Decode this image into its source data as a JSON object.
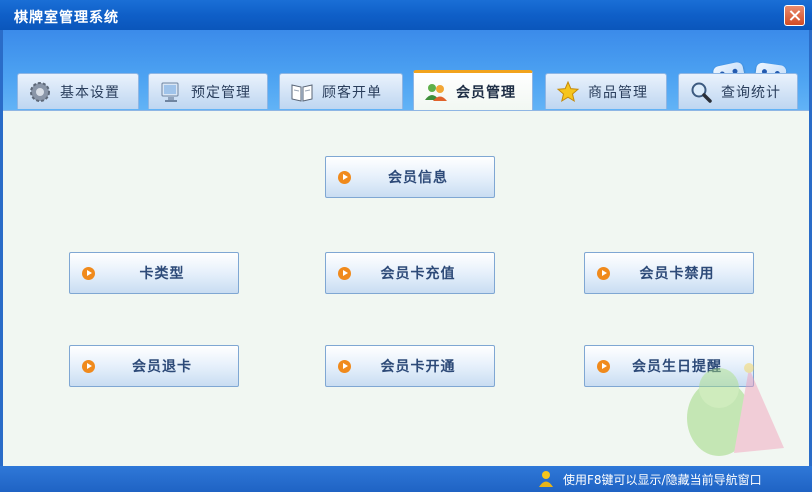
{
  "window": {
    "title": "棋牌室管理系统"
  },
  "tabs": [
    {
      "label": "基本设置",
      "icon": "gear-icon"
    },
    {
      "label": "预定管理",
      "icon": "monitor-icon"
    },
    {
      "label": "顾客开单",
      "icon": "book-icon"
    },
    {
      "label": "会员管理",
      "icon": "members-icon",
      "active": true
    },
    {
      "label": "商品管理",
      "icon": "star-icon"
    },
    {
      "label": "查询统计",
      "icon": "magnifier-icon"
    }
  ],
  "buttons": {
    "member_info": "会员信息",
    "card_type": "卡类型",
    "card_recharge": "会员卡充值",
    "card_disable": "会员卡禁用",
    "card_refund": "会员退卡",
    "card_open": "会员卡开通",
    "birthday_reminder": "会员生日提醒"
  },
  "status": {
    "hint": "使用F8键可以显示/隐藏当前导航窗口"
  },
  "colors": {
    "titlebar": "#0f5fc8",
    "active_tab_accent": "#f1a31c",
    "content_bg": "#f1f7f2",
    "button_text": "#2d4a78",
    "arrow": "#f08a1c"
  }
}
